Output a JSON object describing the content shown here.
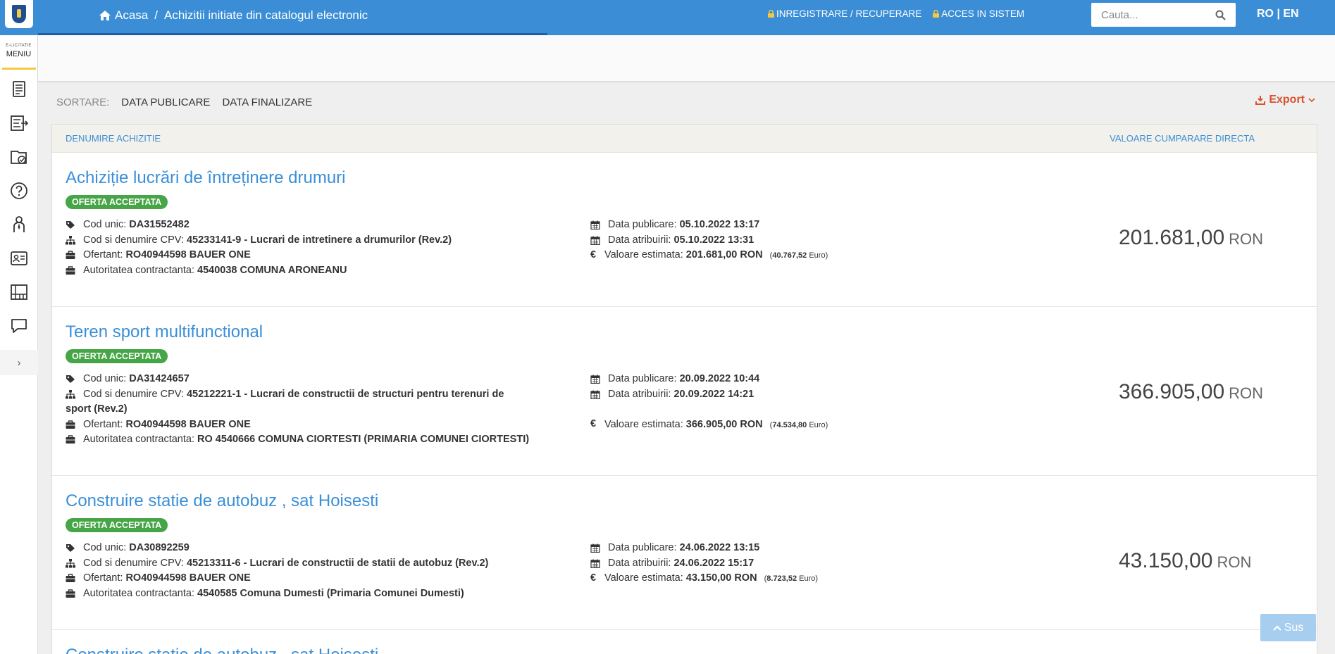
{
  "header": {
    "breadcrumb": {
      "home": "Acasa",
      "separator": "/",
      "current": "Achizitii initiate din catalogul electronic"
    },
    "register_link": "INREGISTRARE / RECUPERARE",
    "login_link": "ACCES IN SISTEM",
    "search_placeholder": "Cauta...",
    "lang": "RO | EN"
  },
  "sidebar": {
    "brand": "E-LICITATIE",
    "menu_label": "MENIU",
    "items": [
      "document-icon",
      "list-export-icon",
      "folder-check-icon",
      "help-icon",
      "user-tie-icon",
      "id-card-icon",
      "table-icon",
      "chat-icon"
    ],
    "expand": "›"
  },
  "sort": {
    "label": "SORTARE:",
    "options": [
      "DATA PUBLICARE",
      "DATA FINALIZARE"
    ]
  },
  "export_label": "Export",
  "list": {
    "col_name": "DENUMIRE ACHIZITIE",
    "col_value": "VALOARE CUMPARARE DIRECTA",
    "labels": {
      "cod": "Cod unic: ",
      "cpv": "Cod si denumire CPV: ",
      "ofertant": "Ofertant: ",
      "autoritate": "Autoritatea contractanta: ",
      "publicare": "Data publicare: ",
      "atribuire": "Data atribuirii: ",
      "valoare": "Valoare estimata: "
    },
    "items": [
      {
        "title": "Achiziție lucrări de întreținere drumuri",
        "status": "OFERTA ACCEPTATA",
        "cod": "DA31552482",
        "cpv": "45233141-9 - Lucrari de intretinere a drumurilor (Rev.2)",
        "ofertant": "RO40944598 BAUER ONE",
        "autoritate": "4540038 COMUNA ARONEANU",
        "publicare": "05.10.2022 13:17",
        "atribuire": "05.10.2022 13:31",
        "valoare": "201.681,00  RON",
        "euro_val": "40.767,52",
        "euro_label": "Euro",
        "price": "201.681,00",
        "currency": "RON"
      },
      {
        "title": "Teren sport multifunctional",
        "status": "OFERTA ACCEPTATA",
        "cod": "DA31424657",
        "cpv": "45212221-1 - Lucrari de constructii de structuri pentru terenuri de",
        "cpv2": "sport (Rev.2)",
        "ofertant": "RO40944598 BAUER ONE",
        "autoritate": "RO 4540666 COMUNA CIORTESTI (PRIMARIA COMUNEI CIORTESTI)",
        "publicare": "20.09.2022 10:44",
        "atribuire": "20.09.2022 14:21",
        "valoare": "366.905,00  RON",
        "euro_val": "74.534,80",
        "euro_label": "Euro",
        "price": "366.905,00",
        "currency": "RON"
      },
      {
        "title": "Construire statie de autobuz , sat Hoisesti",
        "status": "OFERTA ACCEPTATA",
        "cod": "DA30892259",
        "cpv": "45213311-6 - Lucrari de constructii de statii de autobuz (Rev.2)",
        "ofertant": "RO40944598 BAUER ONE",
        "autoritate": "4540585 Comuna Dumesti (Primaria Comunei Dumesti)",
        "publicare": "24.06.2022 13:15",
        "atribuire": "24.06.2022 15:17",
        "valoare": "43.150,00  RON",
        "euro_val": "8.723,52",
        "euro_label": "Euro",
        "price": "43.150,00",
        "currency": "RON"
      },
      {
        "title": "Construire statie de autobuz , sat Hoisesti"
      }
    ]
  },
  "scroll_top_label": "Sus"
}
